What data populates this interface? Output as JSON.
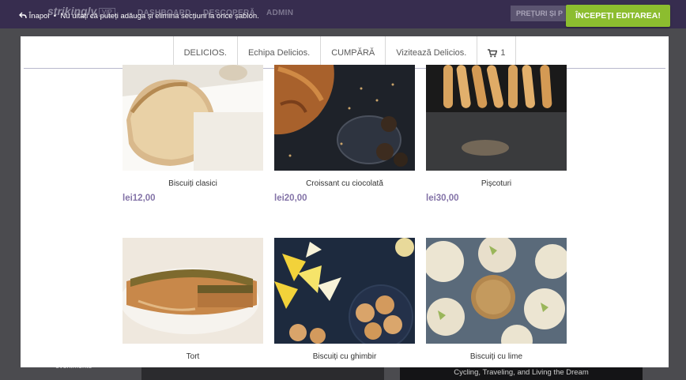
{
  "app": {
    "brand": "strikingly",
    "brand_tag": "VIP",
    "nav": [
      "DASHBOARD",
      "DESCOPERĂ",
      "ADMIN"
    ],
    "pricing": "PREȚURI ȘI P",
    "back_label": "Înapoi",
    "notice": "Nu uitați că puteți adăuga și elimina secțiuni la orice șablon.",
    "start_button": "ÎNCEPEȚI EDITAREA!",
    "accent_color": "#8cbd2f",
    "header_color": "#372d4f"
  },
  "background_page": {
    "left_label": "evenimente",
    "right_text": "Cycling, Traveling, and Living the Dream"
  },
  "site": {
    "nav": [
      {
        "label": "DELICIOS."
      },
      {
        "label": "Echipa Delicios."
      },
      {
        "label": "CUMPĂRĂ"
      },
      {
        "label": "Vizitează Delicios."
      }
    ],
    "cart_count": "1",
    "cart_icon": "shopping-cart-icon",
    "price_color": "#8474a8",
    "products": [
      {
        "name": "Biscuiți clasici",
        "price": "lei12,00"
      },
      {
        "name": "Croissant cu ciocolată",
        "price": "lei20,00"
      },
      {
        "name": "Pișcoturi",
        "price": "lei30,00"
      },
      {
        "name": "Tort",
        "price": ""
      },
      {
        "name": "Biscuiți cu ghimbir",
        "price": ""
      },
      {
        "name": "Biscuiți cu lime",
        "price": ""
      }
    ]
  }
}
